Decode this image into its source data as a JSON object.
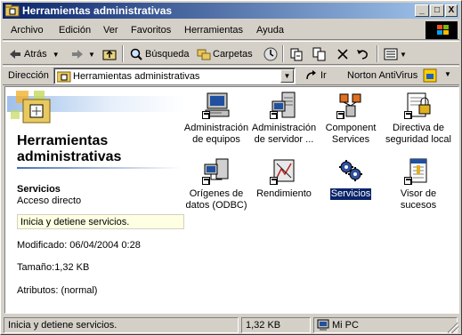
{
  "window": {
    "title": "Herramientas administrativas",
    "buttons": {
      "minimize": "_",
      "maximize": "□",
      "close": "X"
    }
  },
  "menu": [
    "Archivo",
    "Edición",
    "Ver",
    "Favoritos",
    "Herramientas",
    "Ayuda"
  ],
  "toolbar": {
    "back": "Atrás",
    "search": "Búsqueda",
    "folders": "Carpetas"
  },
  "address": {
    "label": "Dirección",
    "value": "Herramientas administrativas",
    "go": "Ir",
    "norton": "Norton AntiVirus"
  },
  "info_pane": {
    "title": "Herramientas administrativas",
    "selected_name": "Servicios",
    "selected_type": "Acceso directo",
    "description": "Inicia y detiene servicios.",
    "modified": "Modificado: 06/04/2004 0:28",
    "size": "Tamaño:1,32 KB",
    "attributes": "Atributos: (normal)"
  },
  "icons": [
    {
      "label": "Administración de equipos",
      "icon": "computer-management-icon"
    },
    {
      "label": "Administración de servidor ...",
      "icon": "server-management-icon"
    },
    {
      "label": "Component Services",
      "icon": "component-services-icon"
    },
    {
      "label": "Directiva de seguridad local",
      "icon": "local-security-policy-icon"
    },
    {
      "label": "Orígenes de datos (ODBC)",
      "icon": "odbc-data-sources-icon"
    },
    {
      "label": "Rendimiento",
      "icon": "performance-icon"
    },
    {
      "label": "Servicios",
      "icon": "services-icon",
      "selected": true
    },
    {
      "label": "Visor de sucesos",
      "icon": "event-viewer-icon"
    }
  ],
  "status": {
    "text": "Inicia y detiene servicios.",
    "size": "1,32 KB",
    "zone": "Mi PC"
  },
  "colors": {
    "titlebar": "#0a246a",
    "face": "#d4d0c8",
    "selection": "#0a246a"
  }
}
